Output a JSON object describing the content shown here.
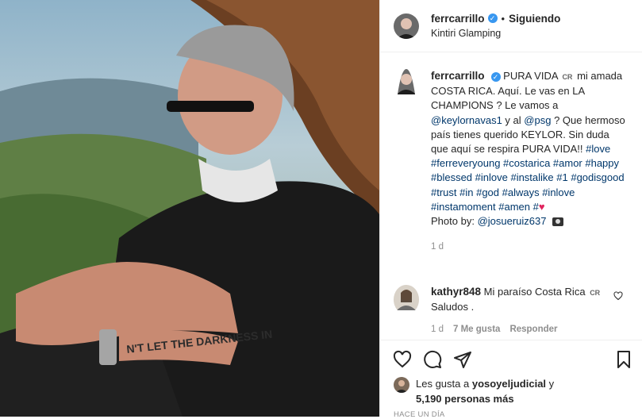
{
  "post": {
    "username": "ferrcarrillo",
    "dot": "•",
    "following_label": "Siguiendo",
    "location": "Kintiri Glamping",
    "photo_tattoo_text": "N'T LET THE DARKNESS IN"
  },
  "caption": {
    "username": "ferrcarrillo",
    "part1": "PURA VIDA",
    "flag1": "CR",
    "part2": "mi amada COSTA RICA. Aquí. Le vas en LA CHAMPIONS ? Le vamos a",
    "mention1": "@keylornavas1",
    "part3": "y al",
    "mention2": "@psg",
    "part4": "? Que hermoso país tienes querido KEYLOR. Sin duda que aquí se respira PURA VIDA!!",
    "hashtags": "#love #ferreveryoung #costarica #amor #happy #blessed #inlove #instalike #1 #godisgood #trust #in #god #always #inlove #instamoment #amen #",
    "heart": "♥",
    "photo_by_label": "Photo by:",
    "photo_by_mention": "@josueruiz637",
    "time": "1 d"
  },
  "comment": {
    "username": "kathyr848",
    "text1": "Mi paraíso Costa Rica",
    "flag": "CR",
    "text2": "Saludos .",
    "time": "1 d",
    "likes": "7 Me gusta",
    "reply": "Responder"
  },
  "likes": {
    "prefix": "Les gusta a",
    "user": "yosoyeljudicial",
    "suffix": "y",
    "count": "5,190 personas más"
  },
  "timestamp": "HACE UN DÍA"
}
